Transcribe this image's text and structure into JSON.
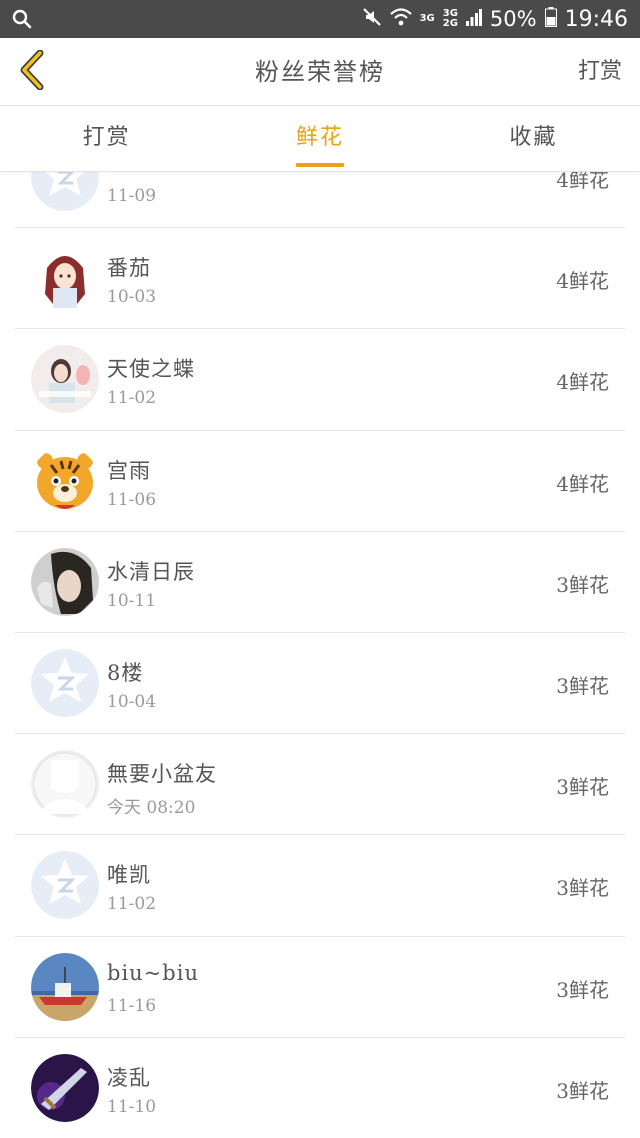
{
  "status_bar": {
    "network_top": "3G",
    "network_mid": "3G",
    "network_bottom": "2G",
    "battery": "50%",
    "time": "19:46"
  },
  "header": {
    "title": "粉丝荣誉榜",
    "action_label": "打赏"
  },
  "tabs": [
    {
      "label": "打赏",
      "active": false
    },
    {
      "label": "鲜花",
      "active": true
    },
    {
      "label": "收藏",
      "active": false
    }
  ],
  "colors": {
    "accent": "#e8a21b",
    "status_bar": "#4a4a4a",
    "text": "#555555",
    "subtext": "#9a9a9a"
  },
  "list": [
    {
      "name": "",
      "date": "11-09",
      "count": "4鲜花",
      "avatar": "qq-default-icon"
    },
    {
      "name": "番茄",
      "date": "10-03",
      "count": "4鲜花",
      "avatar": "anime-girl-icon"
    },
    {
      "name": "天使之蝶",
      "date": "11-02",
      "count": "4鲜花",
      "avatar": "photo-collage-icon"
    },
    {
      "name": "宫雨",
      "date": "11-06",
      "count": "4鲜花",
      "avatar": "tiger-icon"
    },
    {
      "name": "水清日辰",
      "date": "10-11",
      "count": "3鲜花",
      "avatar": "portrait-icon"
    },
    {
      "name": "8楼",
      "date": "10-04",
      "count": "3鲜花",
      "avatar": "qq-default-icon"
    },
    {
      "name": "無要小盆友",
      "date": "今天 08:20",
      "count": "3鲜花",
      "avatar": "silhouette-icon"
    },
    {
      "name": "唯凯",
      "date": "11-02",
      "count": "3鲜花",
      "avatar": "qq-default-icon"
    },
    {
      "name": "biu~biu",
      "date": "11-16",
      "count": "3鲜花",
      "avatar": "boat-icon"
    },
    {
      "name": "凌乱",
      "date": "11-10",
      "count": "3鲜花",
      "avatar": "sword-icon"
    }
  ]
}
